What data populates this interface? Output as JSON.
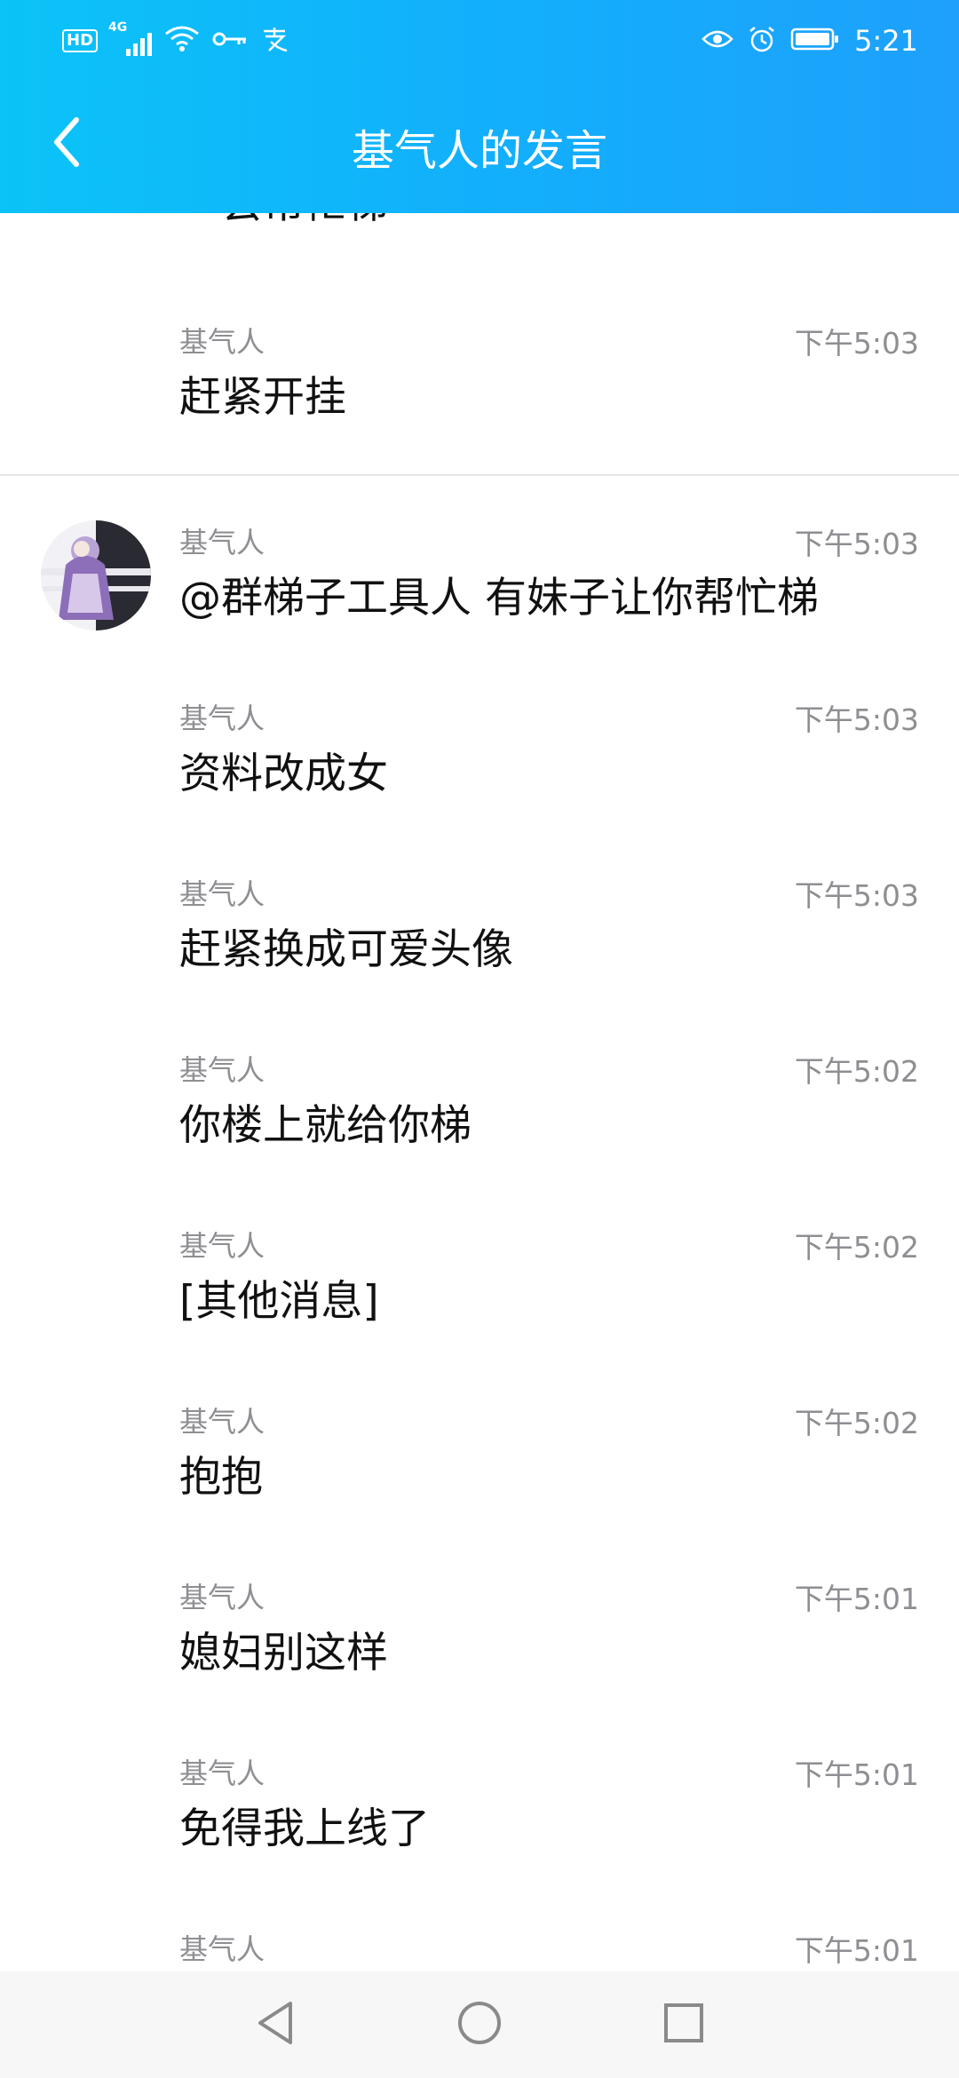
{
  "status_bar": {
    "hd_badge": "HD",
    "network": "4G",
    "time": "5:21"
  },
  "header": {
    "title": "基气人的发言"
  },
  "messages": [
    {
      "sender": "",
      "time": "",
      "text": "一会帮忙梯"
    },
    {
      "sender": "基气人",
      "time": "下午5:03",
      "text": "赶紧开挂"
    },
    {
      "sender": "基气人",
      "time": "下午5:03",
      "text": "@群梯子工具人 有妹子让你帮忙梯"
    },
    {
      "sender": "基气人",
      "time": "下午5:03",
      "text": "资料改成女"
    },
    {
      "sender": "基气人",
      "time": "下午5:03",
      "text": "赶紧换成可爱头像"
    },
    {
      "sender": "基气人",
      "time": "下午5:02",
      "text": "你楼上就给你梯"
    },
    {
      "sender": "基气人",
      "time": "下午5:02",
      "text": "[其他消息]"
    },
    {
      "sender": "基气人",
      "time": "下午5:02",
      "text": "抱抱"
    },
    {
      "sender": "基气人",
      "time": "下午5:01",
      "text": "媳妇别这样"
    },
    {
      "sender": "基气人",
      "time": "下午5:01",
      "text": "免得我上线了"
    },
    {
      "sender": "基气人",
      "time": "下午5:01",
      "text": ""
    }
  ],
  "icons": {
    "back": "back-arrow-icon",
    "nav_back": "triangle-back-icon",
    "nav_home": "circle-home-icon",
    "nav_recents": "square-recents-icon"
  },
  "colors": {
    "header_start": "#0bc3f7",
    "header_end": "#1ea0fb",
    "meta_text": "#8e8e93",
    "message_text": "#111111"
  }
}
